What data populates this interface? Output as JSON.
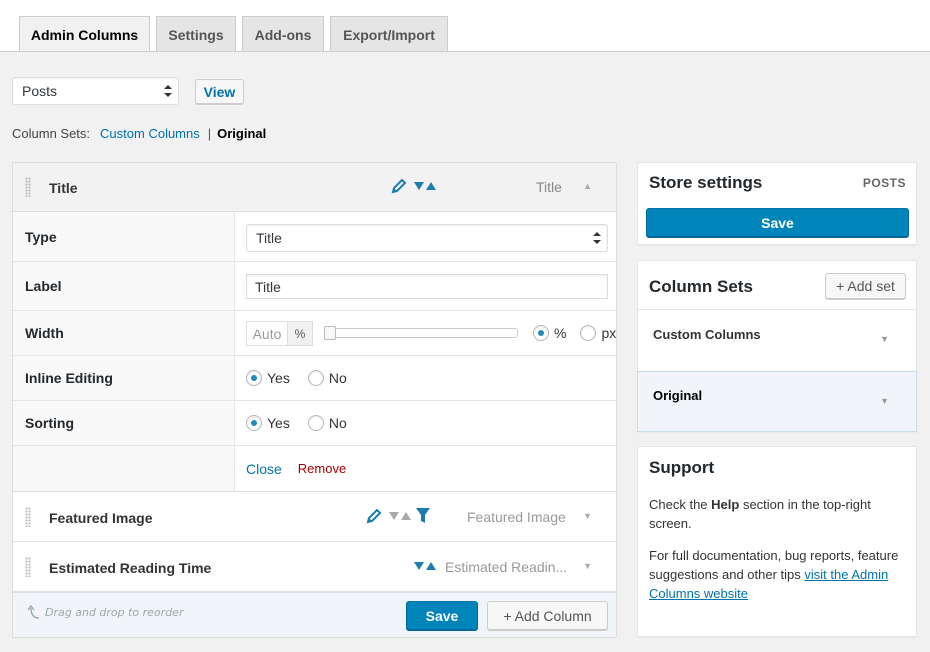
{
  "tabs": [
    {
      "label": "Admin Columns",
      "active": true
    },
    {
      "label": "Settings",
      "active": false
    },
    {
      "label": "Add-ons",
      "active": false
    },
    {
      "label": "Export/Import",
      "active": false
    }
  ],
  "post_type_select": {
    "value": "Posts"
  },
  "view_button": "View",
  "column_sets_line": {
    "label": "Column Sets:",
    "link": "Custom Columns",
    "separator": "|",
    "current": "Original"
  },
  "columns": [
    {
      "title": "Title",
      "type_label": "Title",
      "open": true,
      "icons": [
        "pencil-icon",
        "sort-icon"
      ]
    },
    {
      "title": "Featured Image",
      "type_label": "Featured Image",
      "open": false,
      "icons": [
        "pencil-icon",
        "sort-icon",
        "filter-icon"
      ]
    },
    {
      "title": "Estimated Reading Time",
      "type_label": "Estimated Readin...",
      "open": false,
      "icons": [
        "sort-icon"
      ]
    }
  ],
  "settings_form": {
    "type": {
      "label": "Type",
      "value": "Title"
    },
    "label": {
      "label": "Label",
      "value": "Title"
    },
    "width": {
      "label": "Width",
      "auto": "Auto",
      "unit": "%",
      "opt_percent": "%",
      "opt_px": "px",
      "selected": "%"
    },
    "inline_editing": {
      "label": "Inline Editing",
      "yes": "Yes",
      "no": "No",
      "selected": "Yes"
    },
    "sorting": {
      "label": "Sorting",
      "yes": "Yes",
      "no": "No",
      "selected": "Yes"
    },
    "close": "Close",
    "remove": "Remove"
  },
  "footer": {
    "drag_hint": "Drag and drop to reorder",
    "save": "Save",
    "add_column": "+ Add Column"
  },
  "store_settings": {
    "title": "Store settings",
    "type": "POSTS",
    "save": "Save"
  },
  "column_sets_box": {
    "title": "Column Sets",
    "add_set": "+ Add set",
    "sets": [
      {
        "name": "Custom Columns",
        "active": false
      },
      {
        "name": "Original",
        "active": true
      }
    ]
  },
  "support": {
    "title": "Support",
    "p1_before": "Check the ",
    "p1_bold": "Help",
    "p1_after": " section in the top-right screen.",
    "p2_before": "For full documentation, bug reports, feature suggestions and other tips ",
    "p2_link": "visit the Admin Columns website"
  },
  "colors": {
    "primary": "#0085ba",
    "link": "#0073aa",
    "remove": "#a00",
    "icon_blue": "#1d7dae"
  }
}
